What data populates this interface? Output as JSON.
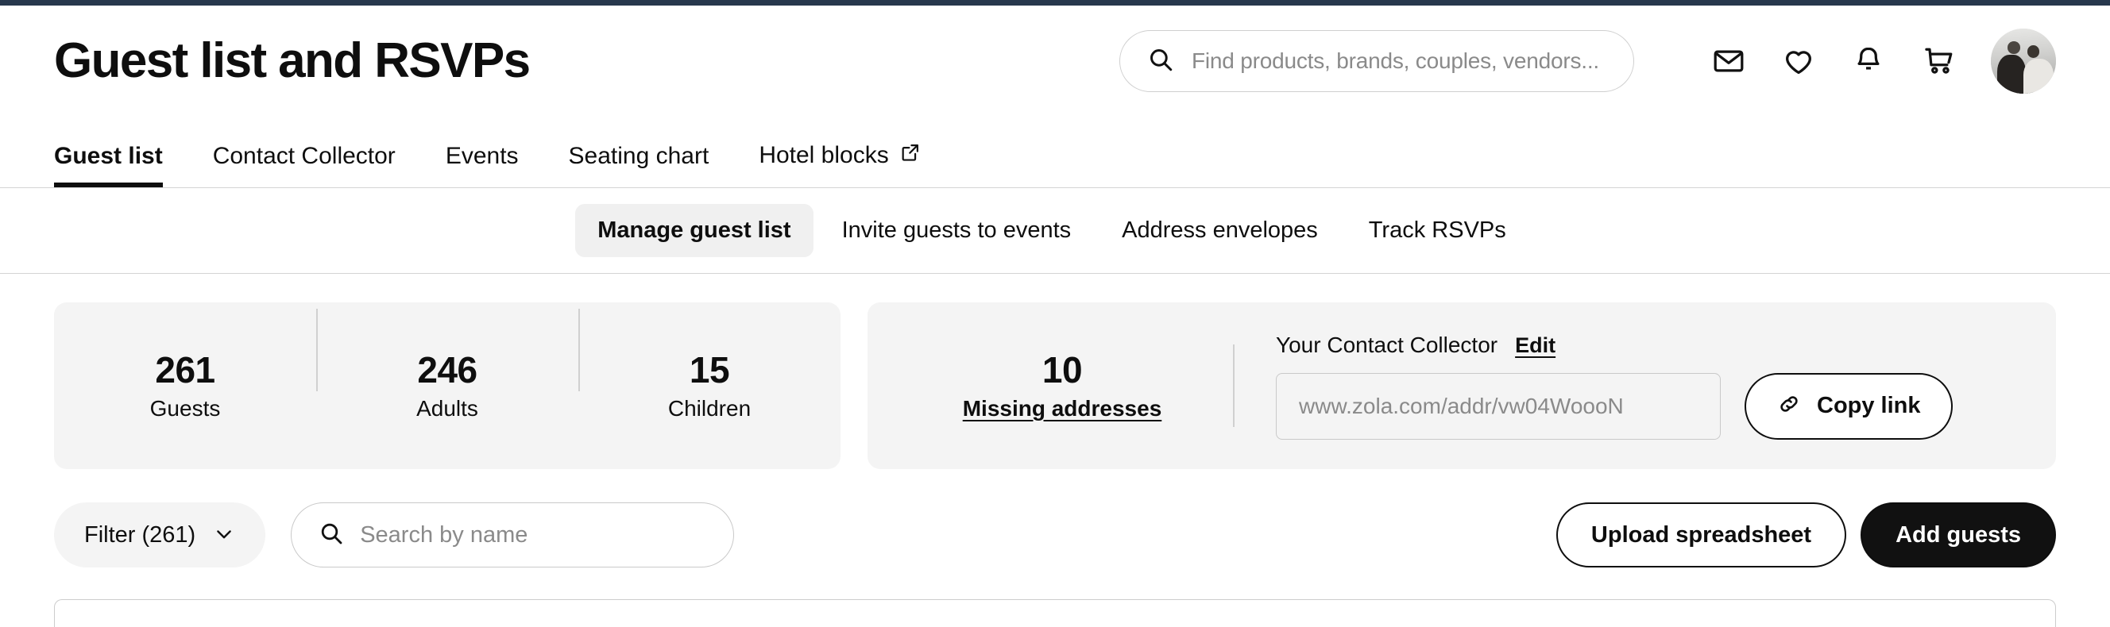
{
  "theme": {
    "accent_bar": "#27384d",
    "text": "#0e0e0e",
    "muted": "#8a8a8a",
    "card_bg": "#f4f4f4",
    "solid_button_bg": "#111111"
  },
  "header": {
    "title": "Guest list and RSVPs",
    "search": {
      "placeholder": "Find products, brands, couples, vendors...",
      "value": "",
      "icon": "search-icon"
    },
    "actions": [
      {
        "name": "messages",
        "icon": "envelope-icon"
      },
      {
        "name": "favorites",
        "icon": "heart-icon"
      },
      {
        "name": "notifications",
        "icon": "bell-icon"
      },
      {
        "name": "cart",
        "icon": "shopping-cart-icon"
      }
    ],
    "avatar": {
      "name": "user-avatar",
      "alt": "Couple profile photo"
    }
  },
  "tabs": [
    {
      "label": "Guest list",
      "active": true,
      "external": false
    },
    {
      "label": "Contact Collector",
      "active": false,
      "external": false
    },
    {
      "label": "Events",
      "active": false,
      "external": false
    },
    {
      "label": "Seating chart",
      "active": false,
      "external": false
    },
    {
      "label": "Hotel blocks",
      "active": false,
      "external": true,
      "icon": "external-link-icon"
    }
  ],
  "subnav": [
    {
      "label": "Manage guest list",
      "selected": true
    },
    {
      "label": "Invite guests to events",
      "selected": false
    },
    {
      "label": "Address envelopes",
      "selected": false
    },
    {
      "label": "Track RSVPs",
      "selected": false
    }
  ],
  "stats_card": {
    "stats": [
      {
        "value": "261",
        "label": "Guests"
      },
      {
        "value": "246",
        "label": "Adults"
      },
      {
        "value": "15",
        "label": "Children"
      }
    ]
  },
  "collector_card": {
    "missing": {
      "value": "10",
      "label": "Missing addresses"
    },
    "label": "Your Contact Collector",
    "edit_label": "Edit",
    "url": "www.zola.com/addr/vw04WoooN",
    "copy_label": "Copy link",
    "copy_icon": "link-icon"
  },
  "toolbar": {
    "filter_label": "Filter (261)",
    "filter_icon": "chevron-down-icon",
    "search_placeholder": "Search by name",
    "search_value": "",
    "search_icon": "search-icon",
    "upload_label": "Upload spreadsheet",
    "add_label": "Add guests"
  }
}
